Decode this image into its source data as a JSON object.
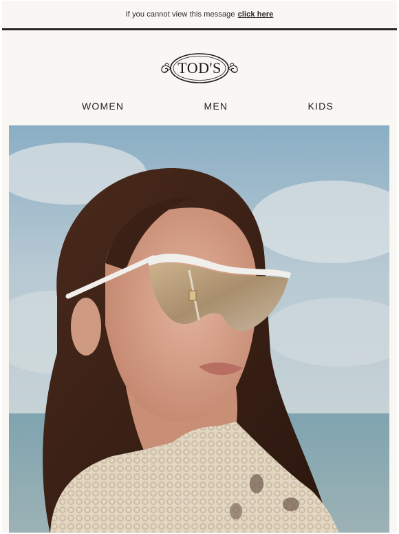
{
  "preheader": {
    "text": "If you cannot view this message",
    "link_label": "click here"
  },
  "brand": {
    "logo_text": "TOD'S"
  },
  "nav": {
    "items": [
      {
        "label": "WOMEN"
      },
      {
        "label": "MEN"
      },
      {
        "label": "KIDS"
      }
    ]
  },
  "hero": {
    "image_name": "woman-wearing-shield-sunglasses-photo"
  },
  "colors": {
    "page_bg": "#f9f7f4",
    "rule": "#2b2422",
    "text": "#222222"
  }
}
